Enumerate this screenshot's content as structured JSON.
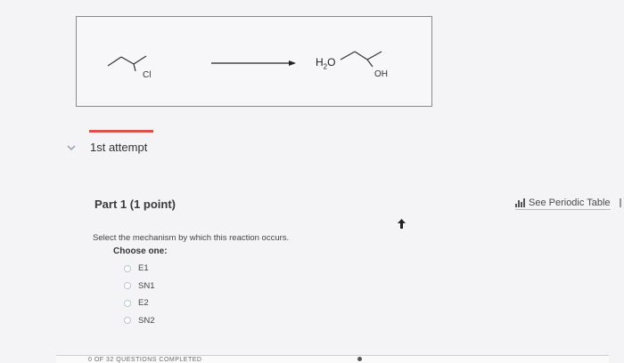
{
  "reaction": {
    "reactant_label": "Cl",
    "product_label": "OH",
    "reagent_main": "H",
    "reagent_sub": "2",
    "reagent_tail": "O"
  },
  "attempt": {
    "label": "1st attempt"
  },
  "part": {
    "title": "Part 1   (1 point)"
  },
  "periodic": {
    "label": "See Periodic Table"
  },
  "question": {
    "text": "Select the mechanism by which this reaction occurs.",
    "choose_label": "Choose one:",
    "options": [
      "E1",
      "SN1",
      "E2",
      "SN2"
    ]
  },
  "footer": {
    "text": "0 OF 32 QUESTIONS COMPLETED"
  },
  "colors": {
    "accent_red": "#d9534f",
    "radio_border": "#b9c3cf"
  }
}
